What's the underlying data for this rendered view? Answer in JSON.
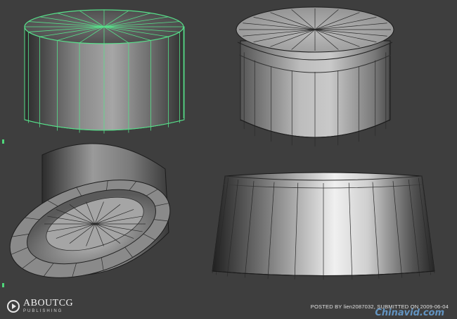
{
  "viewport": {
    "background": "#3e3e3e",
    "wireframe_color": "#57e08a",
    "panels": [
      {
        "name": "top-left",
        "object": "cylinder",
        "selected": true
      },
      {
        "name": "top-right",
        "object": "beveled cylinder",
        "selected": false
      },
      {
        "name": "bottom-left",
        "object": "cylinder ring",
        "selected": false
      },
      {
        "name": "bottom-right",
        "object": "tapered cylinder",
        "selected": false
      }
    ]
  },
  "footer": {
    "brand": "ABOUTCG",
    "brand_sub": "PUBLISHING",
    "credit": "POSTED BY lien2087032, SUBMITTED ON 2009-06-04",
    "watermark": "Chinavid.com"
  }
}
